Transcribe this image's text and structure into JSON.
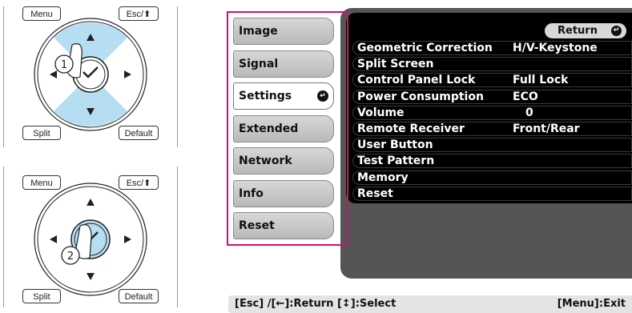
{
  "remote": {
    "menu_label": "Menu",
    "esc_label": "Esc/",
    "split_label": "Split",
    "default_label": "Default",
    "step1": "1",
    "step2": "2"
  },
  "menu": {
    "tabs": [
      {
        "label": "Image",
        "active": false
      },
      {
        "label": "Signal",
        "active": false
      },
      {
        "label": "Settings",
        "active": true
      },
      {
        "label": "Extended",
        "active": false
      },
      {
        "label": "Network",
        "active": false
      },
      {
        "label": "Info",
        "active": false
      },
      {
        "label": "Reset",
        "active": false
      }
    ],
    "return_label": "Return",
    "items": [
      {
        "label": "Geometric Correction",
        "value": "H/V-Keystone"
      },
      {
        "label": "Split Screen",
        "value": ""
      },
      {
        "label": "Control Panel Lock",
        "value": "Full Lock"
      },
      {
        "label": "Power Consumption",
        "value": "ECO"
      },
      {
        "label": "Volume",
        "value": "0"
      },
      {
        "label": "Remote Receiver",
        "value": "Front/Rear"
      },
      {
        "label": "User Button",
        "value": ""
      },
      {
        "label": "Test Pattern",
        "value": ""
      },
      {
        "label": "Memory",
        "value": ""
      },
      {
        "label": "Reset",
        "value": ""
      }
    ]
  },
  "statusbar": {
    "left": "[Esc] /[←]:Return  [↕]:Select",
    "right": "[Menu]:Exit"
  },
  "colors": {
    "highlight_frame": "#d0116e",
    "dpad_highlight": "#b5def2"
  }
}
